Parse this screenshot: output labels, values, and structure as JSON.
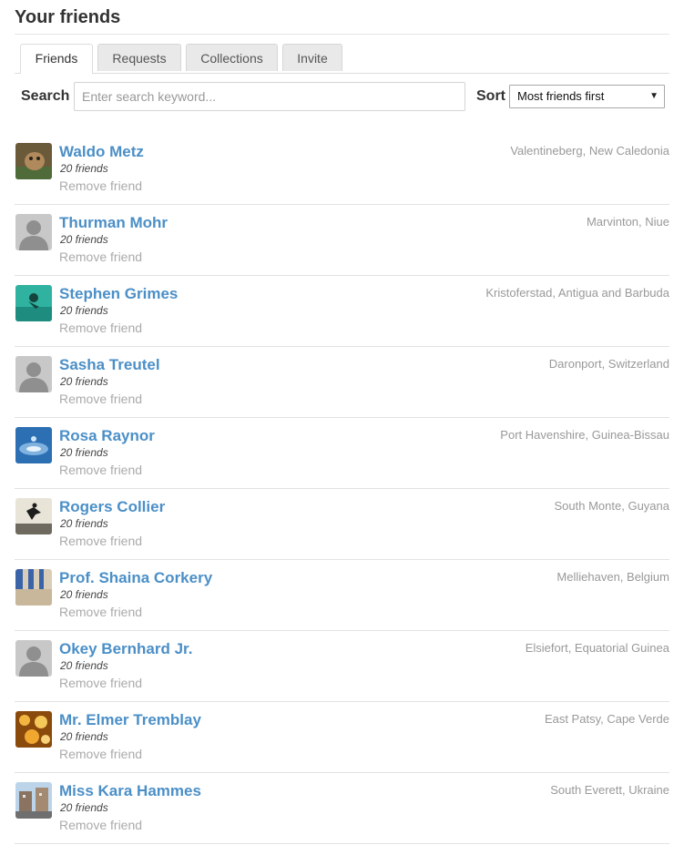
{
  "page": {
    "title": "Your friends"
  },
  "tabs": [
    {
      "label": "Friends",
      "active": true
    },
    {
      "label": "Requests",
      "active": false
    },
    {
      "label": "Collections",
      "active": false
    },
    {
      "label": "Invite",
      "active": false
    }
  ],
  "search": {
    "label": "Search",
    "placeholder": "Enter search keyword...",
    "value": ""
  },
  "sort": {
    "label": "Sort",
    "selected": "Most friends first"
  },
  "colors": {
    "link": "#4b8fc7",
    "muted": "#aaaaaa",
    "location": "#999999"
  },
  "friends": [
    {
      "name": "Waldo Metz",
      "count": "20 friends",
      "remove": "Remove friend",
      "location": "Valentineberg, New Caledonia",
      "avatar": "photo-animal"
    },
    {
      "name": "Thurman Mohr",
      "count": "20 friends",
      "remove": "Remove friend",
      "location": "Marvinton, Niue",
      "avatar": "default-silhouette"
    },
    {
      "name": "Stephen Grimes",
      "count": "20 friends",
      "remove": "Remove friend",
      "location": "Kristoferstad, Antigua and Barbuda",
      "avatar": "photo-underwater"
    },
    {
      "name": "Sasha Treutel",
      "count": "20 friends",
      "remove": "Remove friend",
      "location": "Daronport, Switzerland",
      "avatar": "default-silhouette"
    },
    {
      "name": "Rosa Raynor",
      "count": "20 friends",
      "remove": "Remove friend",
      "location": "Port Havenshire, Guinea-Bissau",
      "avatar": "photo-water-drop"
    },
    {
      "name": "Rogers Collier",
      "count": "20 friends",
      "remove": "Remove friend",
      "location": "South Monte, Guyana",
      "avatar": "photo-jumper"
    },
    {
      "name": "Prof. Shaina Corkery",
      "count": "20 friends",
      "remove": "Remove friend",
      "location": "Melliehaven, Belgium",
      "avatar": "photo-fabric"
    },
    {
      "name": "Okey Bernhard Jr.",
      "count": "20 friends",
      "remove": "Remove friend",
      "location": "Elsiefort, Equatorial Guinea",
      "avatar": "default-silhouette"
    },
    {
      "name": "Mr. Elmer Tremblay",
      "count": "20 friends",
      "remove": "Remove friend",
      "location": "East Patsy, Cape Verde",
      "avatar": "photo-lights"
    },
    {
      "name": "Miss Kara Hammes",
      "count": "20 friends",
      "remove": "Remove friend",
      "location": "South Everett, Ukraine",
      "avatar": "photo-street"
    }
  ]
}
